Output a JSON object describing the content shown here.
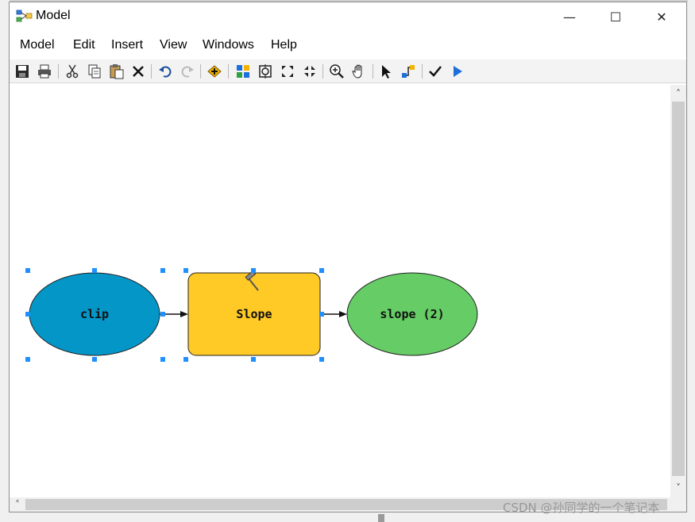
{
  "window": {
    "title": "Model",
    "controls": {
      "minimize": "—",
      "maximize": "☐",
      "close": "✕"
    }
  },
  "menu": [
    "Model",
    "Edit",
    "Insert",
    "View",
    "Windows",
    "Help"
  ],
  "toolbar": {
    "icons": [
      "save-icon",
      "print-icon",
      "cut-icon",
      "copy-icon",
      "paste-icon",
      "delete-icon",
      "undo-icon",
      "redo-icon",
      "add-data-icon",
      "auto-layout-icon",
      "full-extent-icon",
      "zoom-in-fixed-icon",
      "zoom-out-fixed-icon",
      "zoom-in-icon",
      "pan-icon",
      "select-icon",
      "connect-icon",
      "validate-icon",
      "run-icon"
    ]
  },
  "model": {
    "nodes": [
      {
        "id": "clip",
        "label": "clip",
        "type": "input-data",
        "color": "#0596c8",
        "selected": true
      },
      {
        "id": "slope-tool",
        "label": "Slope",
        "type": "tool",
        "color": "#ffc926",
        "selected": true
      },
      {
        "id": "slope-output",
        "label": "slope (2)",
        "type": "output-data",
        "color": "#66cc66",
        "selected": false
      }
    ],
    "connections": [
      {
        "from": "clip",
        "to": "slope-tool"
      },
      {
        "from": "slope-tool",
        "to": "slope-output"
      }
    ]
  },
  "colors": {
    "selection": "#1e90ff",
    "scrollbar": "#cdcdcd"
  },
  "watermark": "CSDN @孙同学的一个笔记本"
}
